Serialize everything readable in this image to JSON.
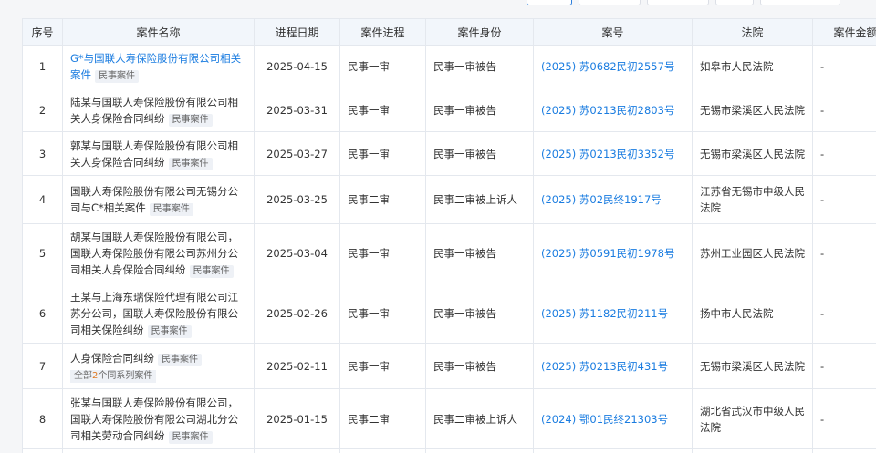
{
  "columns": [
    "序号",
    "案件名称",
    "进程日期",
    "案件进程",
    "案件身份",
    "案号",
    "法院",
    "案件金额"
  ],
  "tag_label": "民事案件",
  "rows": [
    {
      "index": "1",
      "name": "G*与国联人寿保险股份有限公司相关案件",
      "name_is_link": true,
      "date": "2025-04-15",
      "stage": "民事一审",
      "role": "民事一审被告",
      "case_no": "(2025) 苏0682民初2557号",
      "court": "如皋市人民法院",
      "amount": "-"
    },
    {
      "index": "2",
      "name": "陆某与国联人寿保险股份有限公司相关人身保险合同纠纷",
      "name_is_link": false,
      "date": "2025-03-31",
      "stage": "民事一审",
      "role": "民事一审被告",
      "case_no": "(2025) 苏0213民初2803号",
      "court": "无锡市梁溪区人民法院",
      "amount": "-"
    },
    {
      "index": "3",
      "name": "郭某与国联人寿保险股份有限公司相关人身保险合同纠纷",
      "name_is_link": false,
      "date": "2025-03-27",
      "stage": "民事一审",
      "role": "民事一审被告",
      "case_no": "(2025) 苏0213民初3352号",
      "court": "无锡市梁溪区人民法院",
      "amount": "-"
    },
    {
      "index": "4",
      "name": "国联人寿保险股份有限公司无锡分公司与C*相关案件",
      "name_is_link": false,
      "date": "2025-03-25",
      "stage": "民事二审",
      "role": "民事二审被上诉人",
      "case_no": "(2025) 苏02民终1917号",
      "court": "江苏省无锡市中级人民法院",
      "amount": "-"
    },
    {
      "index": "5",
      "name": "胡某与国联人寿保险股份有限公司，国联人寿保险股份有限公司苏州分公司相关人身保险合同纠纷",
      "name_is_link": false,
      "date": "2025-03-04",
      "stage": "民事一审",
      "role": "民事一审被告",
      "case_no": "(2025) 苏0591民初1978号",
      "court": "苏州工业园区人民法院",
      "amount": "-"
    },
    {
      "index": "6",
      "name": "王某与上海东瑞保险代理有限公司江苏分公司，国联人寿保险股份有限公司相关保险纠纷",
      "name_is_link": false,
      "date": "2025-02-26",
      "stage": "民事一审",
      "role": "民事一审被告",
      "case_no": "(2025) 苏1182民初211号",
      "court": "扬中市人民法院",
      "amount": "-"
    },
    {
      "index": "7",
      "name": "人身保险合同纠纷",
      "name_is_link": false,
      "series_prefix": "全部",
      "series_count": "2",
      "series_suffix": "个同系列案件",
      "date": "2025-02-11",
      "stage": "民事一审",
      "role": "民事一审被告",
      "case_no": "(2025) 苏0213民初431号",
      "court": "无锡市梁溪区人民法院",
      "amount": "-"
    },
    {
      "index": "8",
      "name": "张某与国联人寿保险股份有限公司，国联人寿保险股份有限公司湖北分公司相关劳动合同纠纷",
      "name_is_link": false,
      "date": "2025-01-15",
      "stage": "民事二审",
      "role": "民事二审被上诉人",
      "case_no": "(2024) 鄂01民终21303号",
      "court": "湖北省武汉市中级人民法院",
      "amount": "-"
    }
  ]
}
